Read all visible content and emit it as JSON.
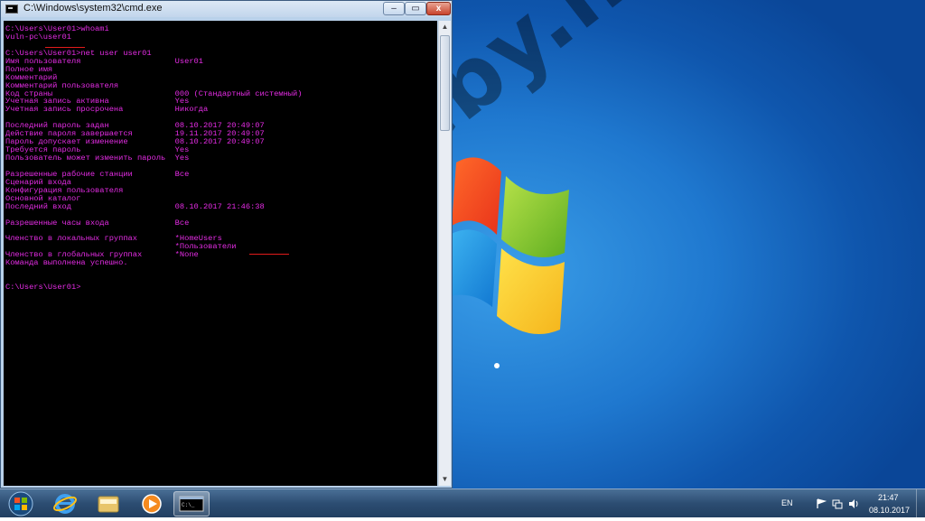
{
  "window": {
    "title": "C:\\Windows\\system32\\cmd.exe",
    "minimize_glyph": "‒",
    "maximize_glyph": "▭",
    "close_glyph": "x"
  },
  "console_lines": [
    "C:\\Users\\User01>whoami",
    "vuln-pc\\user01",
    "",
    "C:\\Users\\User01>net user user01",
    "Имя пользователя                    User01",
    "Полное имя",
    "Комментарий",
    "Комментарий пользователя",
    "Код страны                          000 (Стандартный системный)",
    "Учетная запись активна              Yes",
    "Учетная запись просрочена           Никогда",
    "",
    "Последний пароль задан              08.10.2017 20:49:07",
    "Действие пароля завершается         19.11.2017 20:49:07",
    "Пароль допускает изменение          08.10.2017 20:49:07",
    "Требуется пароль                    Yes",
    "Пользователь может изменить пароль  Yes",
    "",
    "Разрешенные рабочие станции         Все",
    "Сценарий входа",
    "Конфигурация пользователя",
    "Основной каталог",
    "Последний вход                      08.10.2017 21:46:38",
    "",
    "Разрешенные часы входа              Все",
    "",
    "Членство в локальных группах        *HomeUsers",
    "                                    *Пользователи",
    "Членство в глобальных группах       *None",
    "Команда выполнена успешно.",
    "",
    "",
    "C:\\Users\\User01>"
  ],
  "watermark": "codeby.net",
  "taskbar": {
    "items": [
      "start",
      "internet-explorer",
      "file-explorer",
      "media-player",
      "cmd"
    ],
    "language": "EN",
    "clock_time": "21:47",
    "clock_date": "08.10.2017"
  },
  "colors": {
    "console_text": "#e52ce5",
    "console_bg": "#000000",
    "annotation_red": "#e21b1b",
    "desktop_blue": "#1f78cf"
  }
}
